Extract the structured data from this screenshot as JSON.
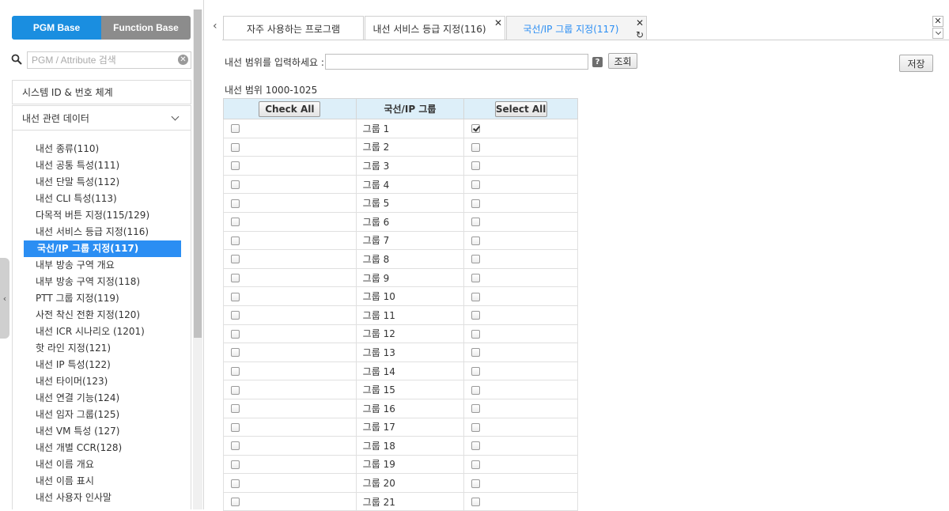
{
  "left": {
    "tabs": [
      {
        "label": "PGM Base",
        "active": true
      },
      {
        "label": "Function Base",
        "active": false
      }
    ],
    "search": {
      "placeholder": "PGM / Attribute 검색",
      "icon": "search-icon"
    },
    "sections": [
      {
        "label": "시스템 ID & 번호 체계",
        "expanded": false
      },
      {
        "label": "내선 관련 데이터",
        "expanded": true
      }
    ],
    "menu": [
      "내선 종류(110)",
      "내선 공통 특성(111)",
      "내선 단말 특성(112)",
      "내선 CLI 특성(113)",
      "다목적 버튼 지정(115/129)",
      "내선 서비스 등급 지정(116)",
      "국선/IP 그룹 지정(117)",
      "내부 방송 구역 개요",
      "내부 방송 구역 지정(118)",
      "PTT 그룹 지정(119)",
      "사전 착신 전환 지정(120)",
      "내선 ICR 시나리오 (1201)",
      "핫 라인 지정(121)",
      "내선 IP 특성(122)",
      "내선 타이머(123)",
      "내선 연결 기능(124)",
      "내선 임자 그룹(125)",
      "내선 VM 특성 (127)",
      "내선 개별 CCR(128)",
      "내선 이름 개요",
      "내선 이름 표시",
      "내선 사용자 인사말"
    ],
    "active_index": 6,
    "scroll_fraction": 0.66
  },
  "right": {
    "tabs": [
      {
        "label": "자주 사용하는 프로그램",
        "closable": false,
        "active": false
      },
      {
        "label": "내선 서비스 등급 지정(116)",
        "closable": true,
        "active": false
      },
      {
        "label": "국선/IP 그룹 지정(117)",
        "closable": true,
        "active": true
      }
    ],
    "form": {
      "range_label": "내선 범위를 입력하세요 :",
      "range_value": "",
      "query_button": "조회",
      "save_button": "저장",
      "range_info": "내선 범위 1000-1025"
    },
    "table": {
      "check_all_label": "Check All",
      "column_label": "국선/IP 그룹",
      "select_all_label": "Select All",
      "rows": [
        {
          "left": false,
          "name": "그룹 1",
          "right": true
        },
        {
          "left": false,
          "name": "그룹 2",
          "right": false
        },
        {
          "left": false,
          "name": "그룹 3",
          "right": false
        },
        {
          "left": false,
          "name": "그룹 4",
          "right": false
        },
        {
          "left": false,
          "name": "그룹 5",
          "right": false
        },
        {
          "left": false,
          "name": "그룹 6",
          "right": false
        },
        {
          "left": false,
          "name": "그룹 7",
          "right": false
        },
        {
          "left": false,
          "name": "그룹 8",
          "right": false
        },
        {
          "left": false,
          "name": "그룹 9",
          "right": false
        },
        {
          "left": false,
          "name": "그룹 10",
          "right": false
        },
        {
          "left": false,
          "name": "그룹 11",
          "right": false
        },
        {
          "left": false,
          "name": "그룹 12",
          "right": false
        },
        {
          "left": false,
          "name": "그룹 13",
          "right": false
        },
        {
          "left": false,
          "name": "그룹 14",
          "right": false
        },
        {
          "left": false,
          "name": "그룹 15",
          "right": false
        },
        {
          "left": false,
          "name": "그룹 16",
          "right": false
        },
        {
          "left": false,
          "name": "그룹 17",
          "right": false
        },
        {
          "left": false,
          "name": "그룹 18",
          "right": false
        },
        {
          "left": false,
          "name": "그룹 19",
          "right": false
        },
        {
          "left": false,
          "name": "그룹 20",
          "right": false
        },
        {
          "left": false,
          "name": "그룹 21",
          "right": false
        }
      ]
    }
  },
  "colors": {
    "accent": "#2b8ef3",
    "tab_on": "#1a8ee0",
    "tab_off": "#8c8c8c",
    "header_bg": "#ddeff9"
  }
}
